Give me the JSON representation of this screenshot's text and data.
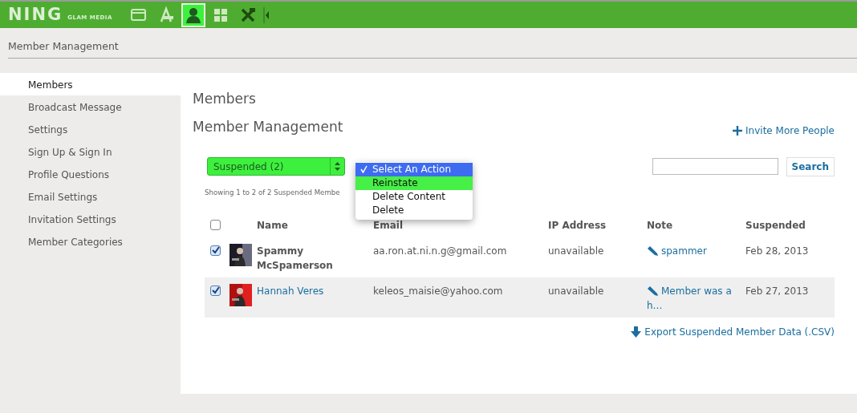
{
  "topbar": {
    "logo": "NING",
    "logo_sub": "GLAM MEDIA",
    "icons": [
      {
        "kind": "window",
        "selected": false
      },
      {
        "kind": "appstore",
        "selected": false
      },
      {
        "kind": "person",
        "selected": true
      },
      {
        "kind": "grid",
        "selected": false
      },
      {
        "kind": "tools",
        "selected": false
      }
    ]
  },
  "page_title": "Member Management",
  "sidebar": {
    "items": [
      {
        "label": "Members",
        "selected": true
      },
      {
        "label": "Broadcast Message",
        "selected": false
      },
      {
        "label": "Settings",
        "selected": false
      },
      {
        "label": "Sign Up & Sign In",
        "selected": false
      },
      {
        "label": "Profile Questions",
        "selected": false
      },
      {
        "label": "Email Settings",
        "selected": false
      },
      {
        "label": "Invitation Settings",
        "selected": false
      },
      {
        "label": "Member Categories",
        "selected": false
      }
    ]
  },
  "heading": "Members",
  "subheading": "Member Management",
  "invite_link": "Invite More People",
  "filter": {
    "value": "Suspended (2)"
  },
  "action_menu": {
    "items": [
      {
        "label": "Select An Action",
        "selected": true,
        "highlighted": false
      },
      {
        "label": "Reinstate",
        "selected": false,
        "highlighted": true
      },
      {
        "label": "Delete Content",
        "selected": false,
        "highlighted": false
      },
      {
        "label": "Delete",
        "selected": false,
        "highlighted": false
      }
    ]
  },
  "search": {
    "button": "Search"
  },
  "showing": "Showing 1 to 2 of 2 Suspended Membe",
  "table": {
    "select_all": {
      "checked": false
    },
    "columns": [
      "Name",
      "Email",
      "IP Address",
      "Note",
      "Suspended"
    ],
    "rows": [
      {
        "checked": true,
        "kind": "plain",
        "name": "Spammy McSpamerson",
        "email": "aa.ron.at.ni.n.g@gmail.com",
        "ip": "unavailable",
        "note": "spammer",
        "suspended": "Feb 28, 2013"
      },
      {
        "checked": true,
        "kind": "link",
        "name": "Hannah Veres",
        "email": "keleos_maisie@yahoo.com",
        "ip": "unavailable",
        "note": "Member was a h…",
        "suspended": "Feb 27, 2013"
      }
    ]
  },
  "export_link": "Export Suspended Member Data (.CSV)"
}
